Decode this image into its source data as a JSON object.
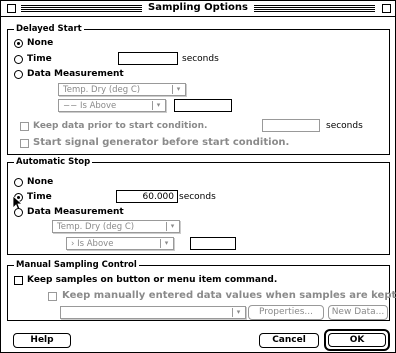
{
  "window": {
    "title": "Sampling Options"
  },
  "delayed_start": {
    "group_title": "Delayed Start",
    "none_label": "None",
    "time_label": "Time",
    "time_value": "",
    "time_unit": "seconds",
    "data_measurement_label": "Data Measurement",
    "sensor_popup": "Temp. Dry (deg C)",
    "condition_popup": "Is Above",
    "threshold_value": "",
    "keep_data_label": "Keep data prior to start condition.",
    "keep_data_seconds_value": "",
    "keep_data_seconds_unit": "seconds",
    "start_signal_label": "Start signal generator before start condition.",
    "selected": "None"
  },
  "automatic_stop": {
    "group_title": "Automatic Stop",
    "none_label": "None",
    "time_label": "Time",
    "time_value": "60.000",
    "time_unit": "seconds",
    "data_measurement_label": "Data Measurement",
    "sensor_popup": "Temp. Dry (deg C)",
    "condition_popup": "Is Above",
    "threshold_value": "",
    "selected": "Time"
  },
  "manual_sampling": {
    "group_title": "Manual Sampling Control",
    "keep_samples_label": "Keep samples on button or menu item command.",
    "keep_manual_label": "Keep manually entered data values when samples are kept.",
    "dataset_popup": "",
    "properties_button": "Properties...",
    "new_data_button": "New Data..."
  },
  "footer": {
    "help_button": "Help",
    "cancel_button": "Cancel",
    "ok_button": "OK"
  }
}
